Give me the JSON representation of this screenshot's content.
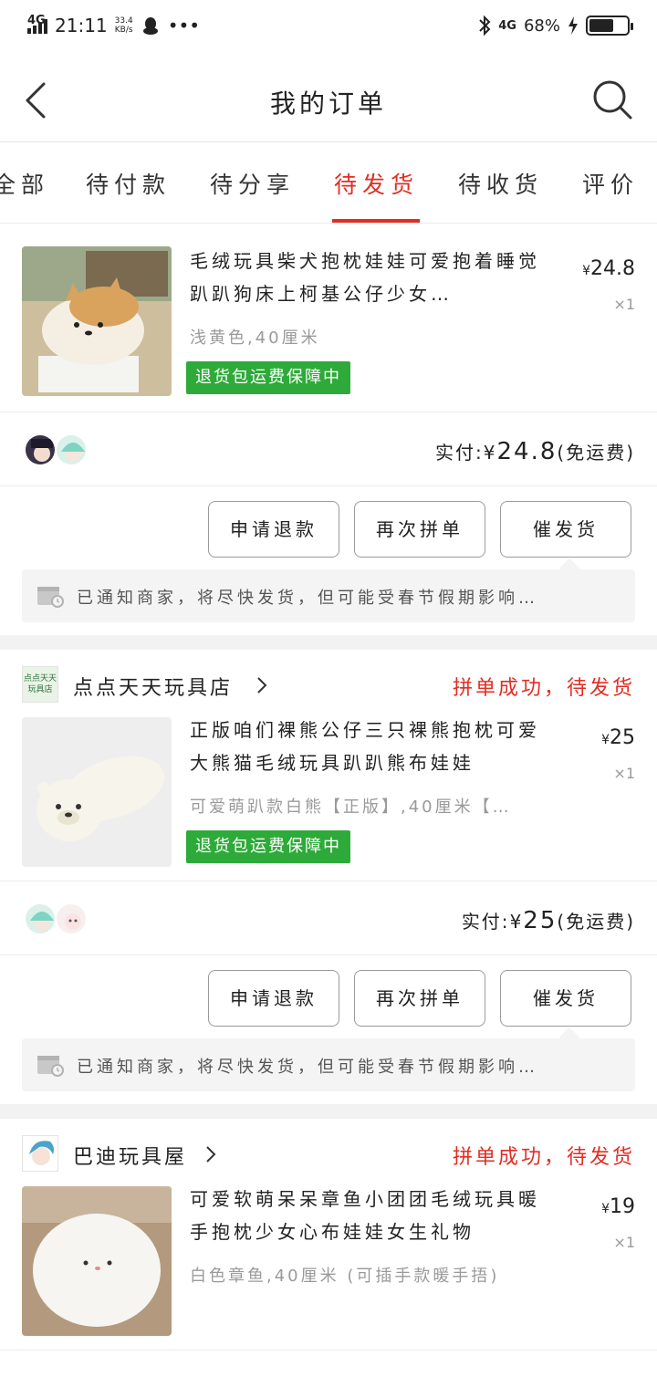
{
  "status_bar": {
    "network": "4G",
    "time": "21:11",
    "speed_value": "33.4",
    "speed_unit": "KB/s",
    "right_network": "4G",
    "battery": "68%",
    "battery_level": 0.68
  },
  "header": {
    "title": "我的订单",
    "back_icon": "chevron-left-icon",
    "search_icon": "search-icon"
  },
  "tabs": [
    {
      "label": "全部"
    },
    {
      "label": "待付款"
    },
    {
      "label": "待分享"
    },
    {
      "label": "待发货",
      "active": true
    },
    {
      "label": "待收货"
    },
    {
      "label": "评价"
    }
  ],
  "colors": {
    "accent": "#e02e24",
    "badge": "#2eaa3a"
  },
  "orders": [
    {
      "product": {
        "name": "毛绒玩具柴犬抱枕娃娃可爱抱着睡觉趴趴狗床上柯基公仔少女…",
        "spec": "浅黄色,40厘米",
        "badge": "退货包运费保障中",
        "price_symbol": "¥",
        "price": "24.8",
        "qty": "×1"
      },
      "paid_label": "实付:",
      "paid_symbol": "¥",
      "paid_amount": "24.8",
      "shipping_note": "(免运费)",
      "buttons": {
        "refund": "申请退款",
        "regroup": "再次拼单",
        "urge": "催发货"
      },
      "notice": "已通知商家，将尽快发货，但可能受春节假期影响…"
    },
    {
      "shop": {
        "name": "点点天天玩具店",
        "logo_text": "点点天天玩具店",
        "status": "拼单成功，待发货"
      },
      "product": {
        "name": "正版咱们裸熊公仔三只裸熊抱枕可爱大熊猫毛绒玩具趴趴熊布娃娃",
        "spec": "可爱萌趴款白熊【正版】,40厘米【…",
        "badge": "退货包运费保障中",
        "price_symbol": "¥",
        "price": "25",
        "qty": "×1"
      },
      "paid_label": "实付:",
      "paid_symbol": "¥",
      "paid_amount": "25",
      "shipping_note": "(免运费)",
      "buttons": {
        "refund": "申请退款",
        "regroup": "再次拼单",
        "urge": "催发货"
      },
      "notice": "已通知商家，将尽快发货，但可能受春节假期影响…"
    },
    {
      "shop": {
        "name": "巴迪玩具屋",
        "status": "拼单成功，待发货"
      },
      "product": {
        "name": "可爱软萌呆呆章鱼小团团毛绒玩具暖手抱枕少女心布娃娃女生礼物",
        "spec": "白色章鱼,40厘米 (可插手款暖手捂)",
        "price_symbol": "¥",
        "price": "19",
        "qty": "×1"
      }
    }
  ]
}
